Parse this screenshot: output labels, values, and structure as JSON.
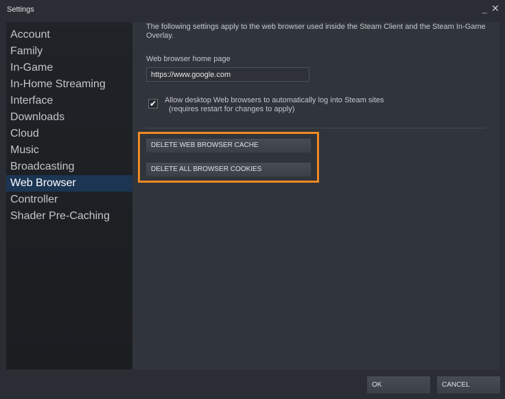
{
  "window": {
    "title": "Settings",
    "minimize_glyph": "_",
    "close_glyph": "✕"
  },
  "sidebar": {
    "items": [
      {
        "label": "Account",
        "active": false
      },
      {
        "label": "Family",
        "active": false
      },
      {
        "label": "In-Game",
        "active": false
      },
      {
        "label": "In-Home Streaming",
        "active": false
      },
      {
        "label": "Interface",
        "active": false
      },
      {
        "label": "Downloads",
        "active": false
      },
      {
        "label": "Cloud",
        "active": false
      },
      {
        "label": "Music",
        "active": false
      },
      {
        "label": "Broadcasting",
        "active": false
      },
      {
        "label": "Web Browser",
        "active": true
      },
      {
        "label": "Controller",
        "active": false
      },
      {
        "label": "Shader Pre-Caching",
        "active": false
      }
    ]
  },
  "content": {
    "description": "The following settings apply to the web browser used inside the Steam Client and the Steam In-Game Overlay.",
    "home_page_label": "Web browser home page",
    "home_page_value": "https://www.google.com",
    "auto_login": {
      "checked": true,
      "check_glyph": "✔",
      "label": "Allow desktop Web browsers to automatically log into Steam sites",
      "sublabel": "(requires restart for changes to apply)"
    },
    "delete_cache_label": "DELETE WEB BROWSER CACHE",
    "delete_cookies_label": "DELETE ALL BROWSER COOKIES",
    "highlight_color": "#f08a24"
  },
  "footer": {
    "ok_label": "OK",
    "cancel_label": "CANCEL"
  }
}
